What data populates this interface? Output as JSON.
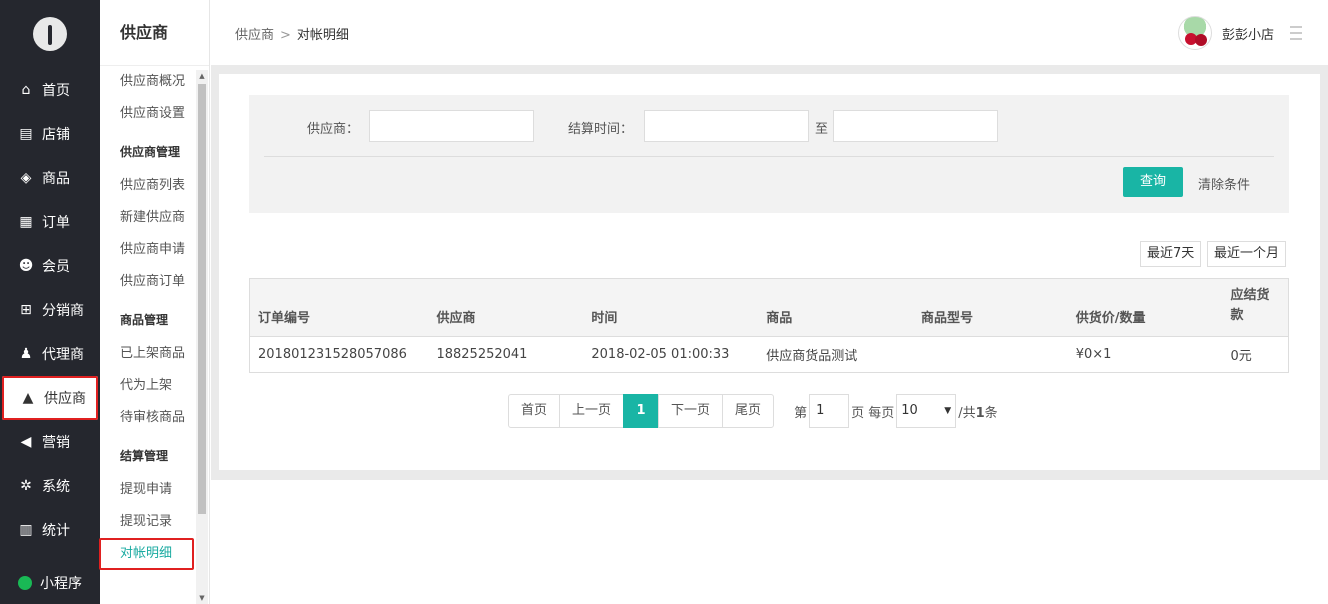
{
  "nav": {
    "items": [
      {
        "label": "首页",
        "icon": "home-icon",
        "glyph": "⌂"
      },
      {
        "label": "店铺",
        "icon": "store-icon",
        "glyph": "▤"
      },
      {
        "label": "商品",
        "icon": "box-icon",
        "glyph": "◈"
      },
      {
        "label": "订单",
        "icon": "basket-icon",
        "glyph": "▦"
      },
      {
        "label": "会员",
        "icon": "member-icon",
        "glyph": "☻"
      },
      {
        "label": "分销商",
        "icon": "sitemap-icon",
        "glyph": "⊞"
      },
      {
        "label": "代理商",
        "icon": "agent-icon",
        "glyph": "♟"
      },
      {
        "label": "供应商",
        "icon": "warehouse-icon",
        "glyph": "▲"
      },
      {
        "label": "营销",
        "icon": "megaphone-icon",
        "glyph": "◀"
      },
      {
        "label": "系统",
        "icon": "gear-icon",
        "glyph": "✲"
      },
      {
        "label": "统计",
        "icon": "bar-chart-icon",
        "glyph": "▥"
      }
    ],
    "mini_label": "小程序"
  },
  "subnav": {
    "title": "供应商",
    "items_a": [
      "供应商概况",
      "供应商设置"
    ],
    "group_b": "供应商管理",
    "items_b": [
      "供应商列表",
      "新建供应商",
      "供应商申请",
      "供应商订单"
    ],
    "group_c": "商品管理",
    "items_c": [
      "已上架商品",
      "代为上架",
      "待审核商品"
    ],
    "group_d": "结算管理",
    "items_d": [
      "提现申请",
      "提现记录",
      "对帐明细"
    ]
  },
  "header": {
    "breadcrumb_parent": "供应商",
    "breadcrumb_sep": ">",
    "breadcrumb_current": "对帐明细",
    "username": "彭彭小店"
  },
  "filter": {
    "supplier_label": "供应商：",
    "supplier_value": "",
    "time_label": "结算时间：",
    "time_start": "",
    "to_label": "至",
    "time_end": "",
    "query_label": "查询",
    "clear_label": "清除条件"
  },
  "quick": {
    "last7": "最近7天",
    "last_month": "最近一个月"
  },
  "table": {
    "headers": [
      "订单编号",
      "供应商",
      "时间",
      "商品",
      "商品型号",
      "供货价/数量",
      "应结货款"
    ],
    "rows": [
      [
        "201801231528057086",
        "18825252041",
        "2018-02-05 01:00:33",
        "供应商货品测试",
        "",
        "¥0×1",
        "0元"
      ]
    ]
  },
  "pager": {
    "first": "首页",
    "prev": "上一页",
    "current": "1",
    "next": "下一页",
    "last": "尾页",
    "page_prefix": "第",
    "page_input": "1",
    "page_suffix": "页 每页",
    "per_page": "10",
    "total_prefix": "/共",
    "total": "1",
    "total_suffix": "条"
  },
  "colors": {
    "accent": "#19b5a5",
    "nav_bg": "#25272e",
    "highlight": "#e02020"
  }
}
